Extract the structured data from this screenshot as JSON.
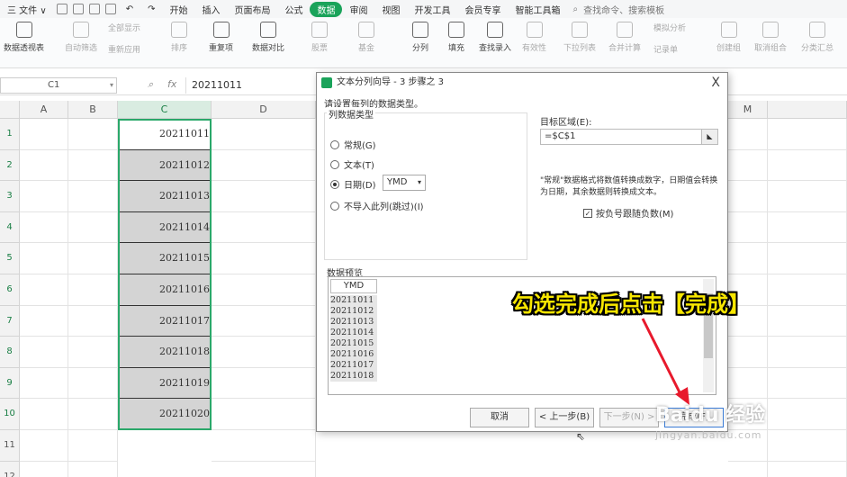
{
  "menu": {
    "file": "三 文件 ∨",
    "tabs": [
      "开始",
      "插入",
      "页面布局",
      "公式",
      "数据",
      "审阅",
      "视图",
      "开发工具",
      "会员专享",
      "智能工具箱"
    ],
    "active_tab": "数据",
    "search": "查找命令、搜索模板"
  },
  "ribbon": {
    "data_pivot": "数据透视表",
    "auto_filter": "自动筛选",
    "show_all": "全部显示",
    "reapply": "重新应用",
    "sort": "排序",
    "duplicates": "重复项",
    "compare": "数据对比",
    "stock": "股票",
    "fund": "基金",
    "split": "分列",
    "fill": "填充",
    "lookup": "查找录入",
    "validity": "有效性",
    "dropdown": "下拉列表",
    "consolidate": "合并计算",
    "record": "记录单",
    "whatif": "模拟分析",
    "group": "创建组",
    "ungroup": "取消组合",
    "subtotal": "分类汇总"
  },
  "formula_bar": {
    "cell_ref": "C1",
    "fx": "fx",
    "value": "20211011"
  },
  "grid": {
    "columns": [
      "A",
      "B",
      "C",
      "D",
      "M"
    ],
    "rows": [
      "1",
      "2",
      "3",
      "4",
      "5",
      "6",
      "7",
      "8",
      "9",
      "10",
      "11",
      "12"
    ],
    "c_values": [
      "20211011",
      "20211012",
      "20211013",
      "20211014",
      "20211015",
      "20211016",
      "20211017",
      "20211018",
      "20211019",
      "20211020"
    ]
  },
  "dialog": {
    "title": "文本分列向导 - 3 步骤之 3",
    "close": "X",
    "prompt": "请设置每列的数据类型。",
    "group_label": "列数据类型",
    "opt_general": "常规(G)",
    "opt_text": "文本(T)",
    "opt_date": "日期(D)",
    "date_format": "YMD",
    "opt_skip": "不导入此列(跳过)(I)",
    "target_label": "目标区域(E):",
    "target_value": "=$C$1",
    "note": "\"常规\"数据格式将数值转换成数字，日期值会转换为日期，其余数据则转换成文本。",
    "neg_check": "按负号跟随负数(M)",
    "preview_label": "数据预览",
    "preview_header": "YMD",
    "preview_values": [
      "20211011",
      "20211012",
      "20211013",
      "20211014",
      "20211015",
      "20211016",
      "20211017",
      "20211018"
    ],
    "btn_cancel": "取消",
    "btn_prev": "< 上一步(B)",
    "btn_next": "下一步(N) >",
    "btn_finish": "完成(F)"
  },
  "annotation": "勾选完成后点击【完成】",
  "watermark": {
    "brand": "Baidu 经验",
    "url": "jingyan.baidu.com"
  },
  "colors": {
    "accent": "#1aa35a",
    "selection_border": "#2aa86a",
    "annotation": "#f7e600",
    "arrow": "#e8192c"
  }
}
